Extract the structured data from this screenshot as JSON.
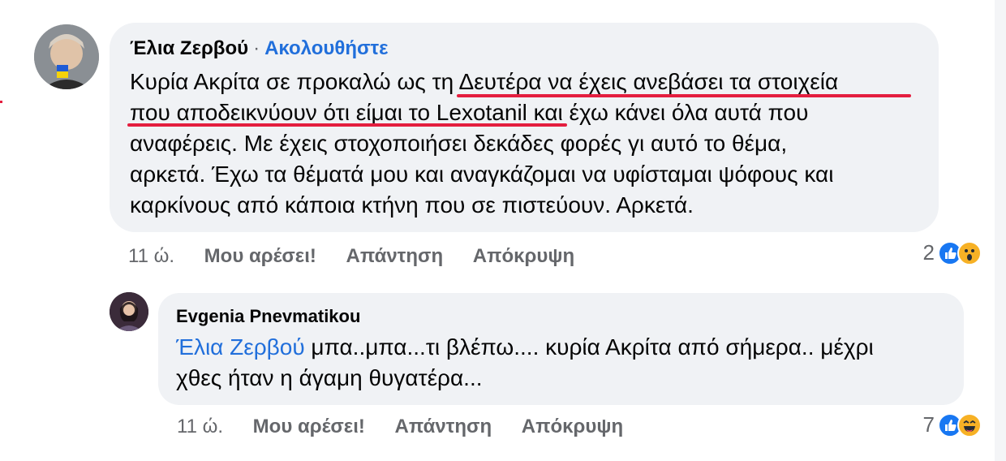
{
  "comment1": {
    "author": "Έλια Ζερβού",
    "separator": "·",
    "follow": "Ακολουθήστε",
    "lines": [
      "Κυρία Ακρίτα σε προκαλώ ως τη Δευτέρα να έχεις ανεβάσει τα στοιχεία",
      "που αποδεικνύουν ότι είμαι το Lexotanil και έχω κάνει όλα αυτά που",
      "αναφέρεις.  Με έχεις στοχοποιήσει δεκάδες φορές γι αυτό το θέμα,",
      "αρκετά. Έχω τα θέματά μου και αναγκάζομαι να υφίσταμαι ψόφους και",
      "καρκίνους από κάποια κτήνη που σε πιστεύουν. Αρκετά."
    ],
    "time": "11 ώ.",
    "like": "Μου αρέσει!",
    "reply": "Απάντηση",
    "hide": "Απόκρυψη",
    "reaction_count": "2",
    "reaction_icons": [
      "like-icon",
      "wow-icon"
    ]
  },
  "comment2": {
    "author": "Evgenia Pnevmatikou",
    "mention": "Έλια Ζερβού",
    "text_line1": " μπα..μπα...τι βλέπω.... κυρία Ακρίτα από σήμερα.. μέχρι",
    "text_line2": "χθες ήταν η άγαμη θυγατέρα...",
    "time": "11 ώ.",
    "like": "Μου αρέσει!",
    "reply": "Απάντηση",
    "hide": "Απόκρυψη",
    "reaction_count": "7",
    "reaction_icons": [
      "like-icon",
      "haha-icon"
    ]
  },
  "colors": {
    "bubble": "#f0f2f5",
    "link_blue": "#216fdb",
    "meta_gray": "#65676b",
    "underline_red": "#e41e3f"
  }
}
